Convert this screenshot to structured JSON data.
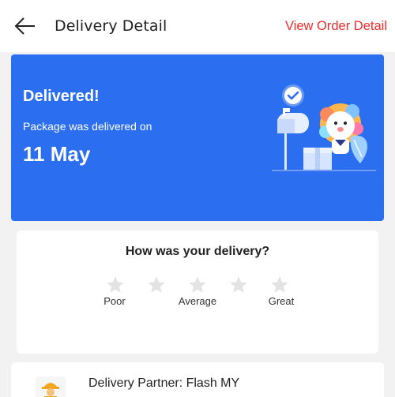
{
  "header": {
    "back_icon": "arrow-left-icon",
    "title": "Delivery Detail",
    "order_link": "View Order Detail"
  },
  "banner": {
    "status": "Delivered!",
    "subtitle": "Package was delivered on",
    "date": "11 May",
    "background_color": "#2b6ff0"
  },
  "rating": {
    "question": "How was your delivery?",
    "stars": 5,
    "selected": 0,
    "labels": {
      "poor": "Poor",
      "average": "Average",
      "great": "Great"
    }
  },
  "partner": {
    "icon": "delivery-person-icon",
    "label": "Delivery Partner: Flash MY"
  },
  "colors": {
    "accent": "#ee2c2c",
    "star_inactive": "#e3e3e3"
  }
}
